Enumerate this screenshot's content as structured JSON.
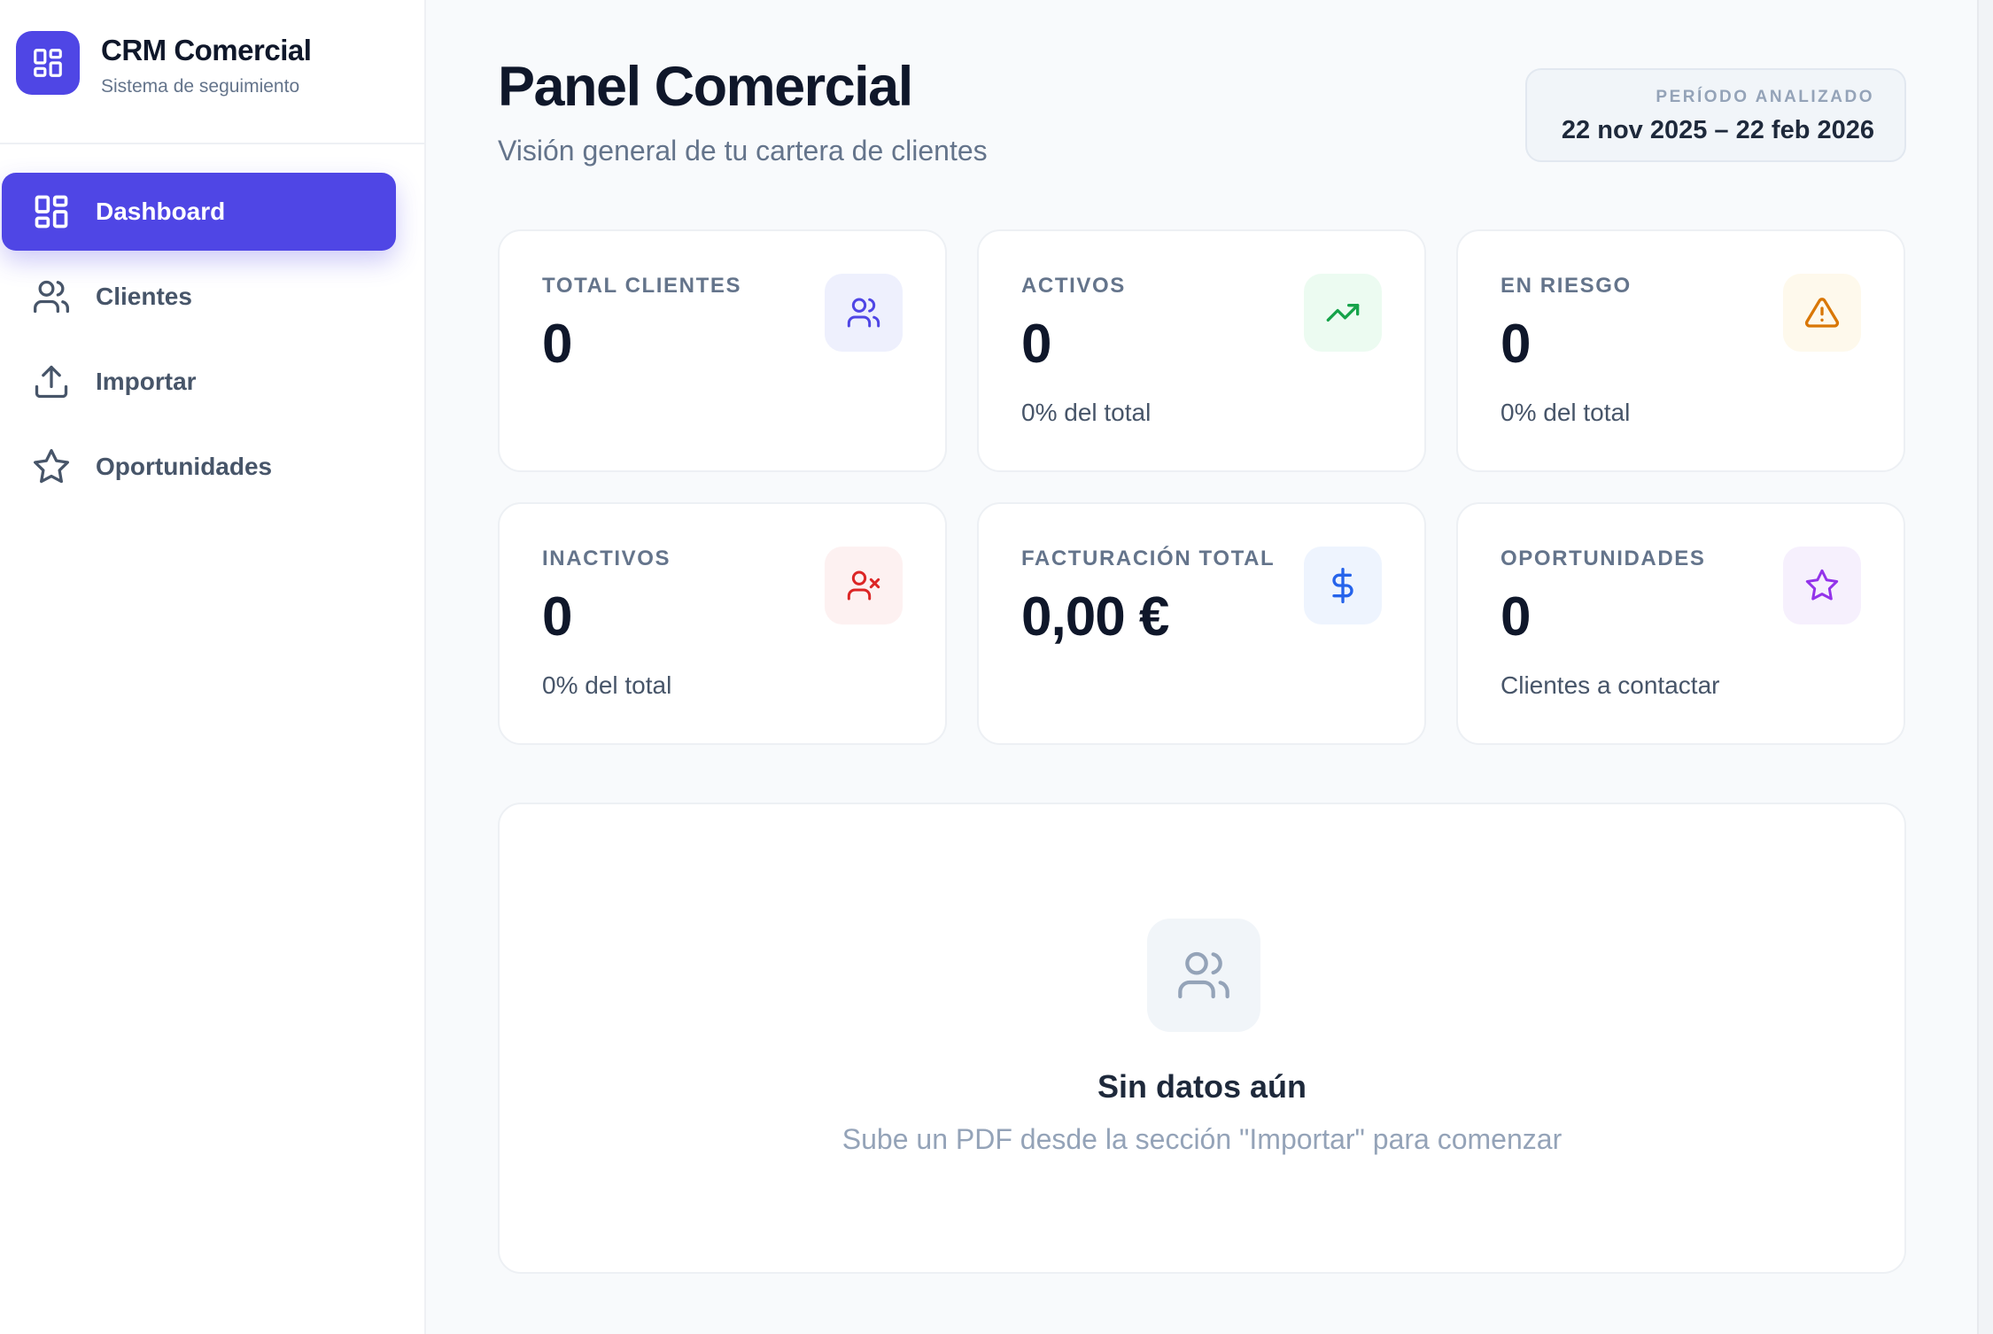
{
  "brand": {
    "title": "CRM Comercial",
    "subtitle": "Sistema de seguimiento"
  },
  "nav": {
    "items": [
      {
        "label": "Dashboard",
        "icon": "dashboard-icon",
        "active": true
      },
      {
        "label": "Clientes",
        "icon": "users-icon",
        "active": false
      },
      {
        "label": "Importar",
        "icon": "upload-icon",
        "active": false
      },
      {
        "label": "Oportunidades",
        "icon": "star-icon",
        "active": false
      }
    ]
  },
  "header": {
    "title": "Panel Comercial",
    "subtitle": "Visión general de tu cartera de clientes"
  },
  "period": {
    "label": "PERÍODO ANALIZADO",
    "value": "22 nov 2025 – 22 feb 2026"
  },
  "cards": [
    {
      "label": "TOTAL CLIENTES",
      "value": "0",
      "sub": "",
      "icon": "users-icon",
      "color": "#4f46e5",
      "bg": "#eef0fd"
    },
    {
      "label": "ACTIVOS",
      "value": "0",
      "sub": "0% del total",
      "icon": "trending-up-icon",
      "color": "#16a34a",
      "bg": "#ecfbf1"
    },
    {
      "label": "EN RIESGO",
      "value": "0",
      "sub": "0% del total",
      "icon": "warning-icon",
      "color": "#d97706",
      "bg": "#fef9ec"
    },
    {
      "label": "INACTIVOS",
      "value": "0",
      "sub": "0% del total",
      "icon": "user-x-icon",
      "color": "#dc2626",
      "bg": "#fdf1f1"
    },
    {
      "label": "FACTURACIÓN TOTAL",
      "value": "0,00 €",
      "sub": "",
      "icon": "dollar-icon",
      "color": "#2563eb",
      "bg": "#eef4fe"
    },
    {
      "label": "OPORTUNIDADES",
      "value": "0",
      "sub": "Clientes a contactar",
      "icon": "star-icon",
      "color": "#9333ea",
      "bg": "#f6f0fd"
    }
  ],
  "empty": {
    "title": "Sin datos aún",
    "subtitle": "Sube un PDF desde la sección \"Importar\" para comenzar",
    "icon": "users-icon"
  },
  "colors": {
    "accent": "#4f46e5"
  }
}
